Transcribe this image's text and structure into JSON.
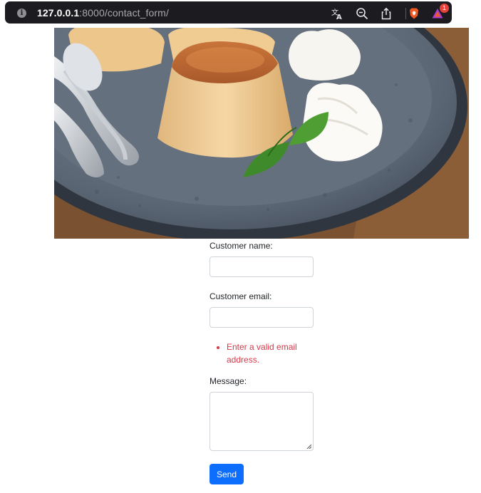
{
  "browser": {
    "url_host": "127.0.0.1",
    "url_rest": ":8000/contact_form/",
    "info_icon": "info-icon",
    "toolbar_icons": [
      "translate-icon",
      "zoom-out-icon",
      "share-icon",
      "brave-shield-icon",
      "brave-rewards-icon"
    ],
    "notification_count": "1"
  },
  "hero": {
    "image": "flan-dessert-photo",
    "next_icon": "chevron-right-icon"
  },
  "form": {
    "name_label": "Customer name:",
    "name_value": "",
    "email_label": "Customer email:",
    "email_value": "",
    "email_error": "Enter a valid email address.",
    "message_label": "Message:",
    "message_value": "",
    "submit_label": "Send"
  },
  "colors": {
    "primary": "#0d6efd",
    "error": "#dc3545",
    "address_bar": "#1c1c20",
    "brave_orange": "#f15a22"
  }
}
